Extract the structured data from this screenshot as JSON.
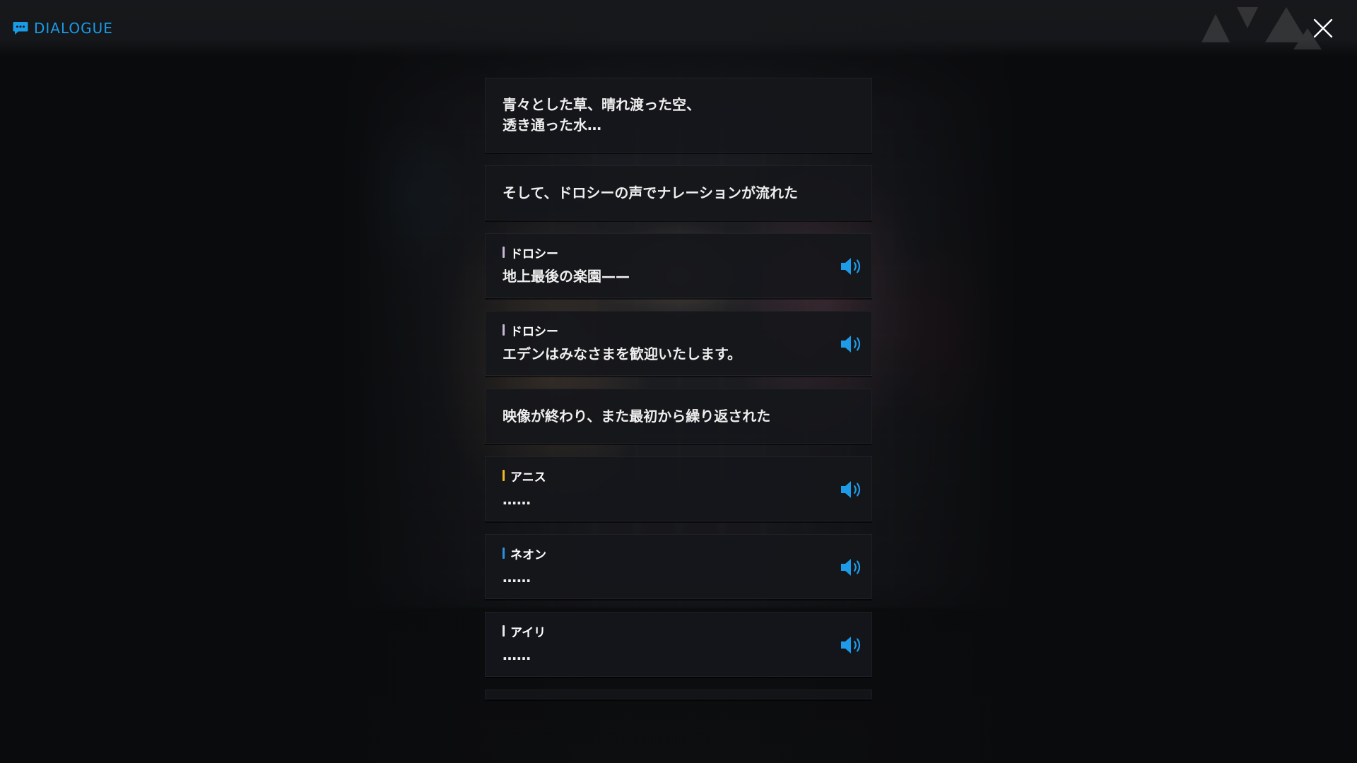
{
  "header": {
    "title": "DIALOGUE",
    "accent_color": "#1a9be6",
    "icon": "chat-bubble-icon"
  },
  "close_icon": "close-icon",
  "voice_icon": "speaker-volume-icon",
  "entries": [
    {
      "type": "narration",
      "text": "青々とした草、晴れ渡った空、\n透き通った水…"
    },
    {
      "type": "narration",
      "text": "そして、ドロシーの声でナレーションが流れた"
    },
    {
      "type": "speech",
      "speaker": "ドロシー",
      "speaker_color": "#c7b6d6",
      "text": "地上最後の楽園——"
    },
    {
      "type": "speech",
      "speaker": "ドロシー",
      "speaker_color": "#c7b6d6",
      "text": "エデンはみなさまを歓迎いたします。"
    },
    {
      "type": "narration",
      "text": "映像が終わり、また最初から繰り返された"
    },
    {
      "type": "speech",
      "speaker": "アニス",
      "speaker_color": "#f2b824",
      "text": "……"
    },
    {
      "type": "speech",
      "speaker": "ネオン",
      "speaker_color": "#2a8fe0",
      "text": "……"
    },
    {
      "type": "speech",
      "speaker": "アイリ",
      "speaker_color": "#e8e8e8",
      "text": "……"
    }
  ]
}
